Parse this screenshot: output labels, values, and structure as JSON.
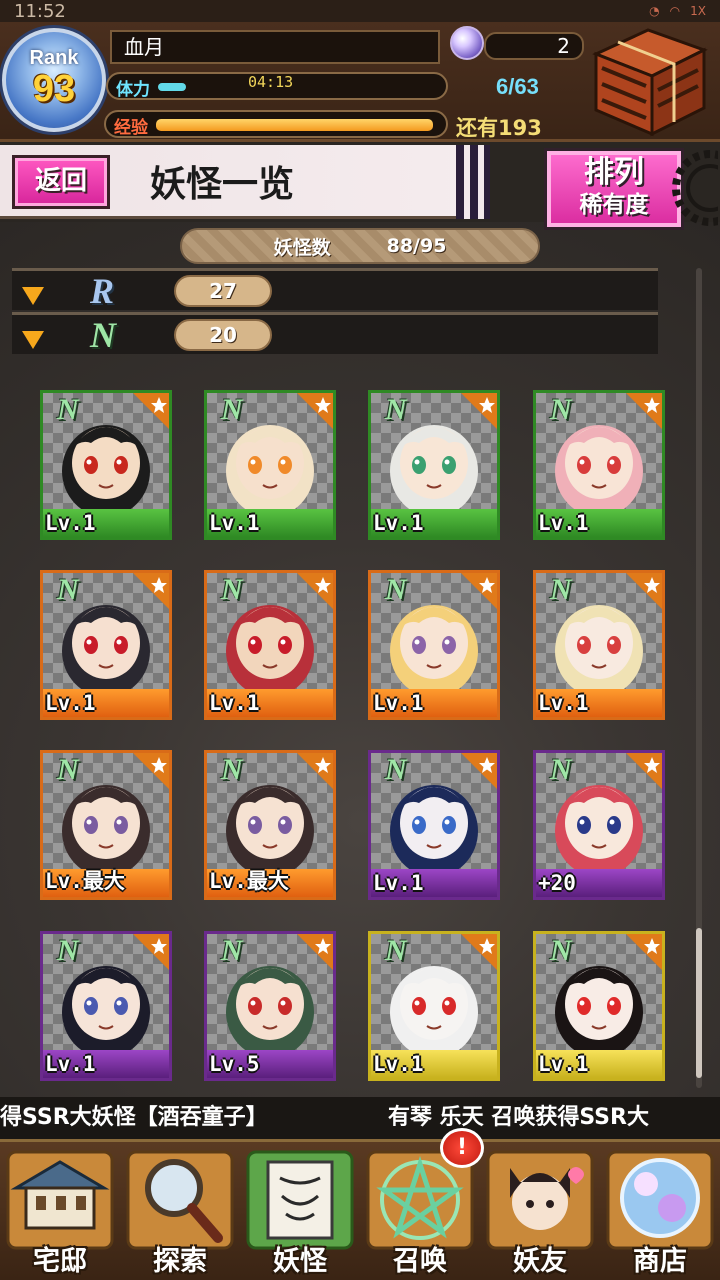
{
  "status_bar": {
    "time": "11:52",
    "right": "1X"
  },
  "player": {
    "rank_label": "Rank",
    "rank": "93",
    "name": "血月",
    "orb_count": "2",
    "stamina_label": "体力",
    "stamina_timer": "04:13",
    "stamina_count": "6/63",
    "stamina_fraction": 0.1,
    "exp_label": "经验",
    "exp_remaining": "还有193",
    "exp_fraction": 0.97
  },
  "title_bar": {
    "back_label": "返回",
    "title": "妖怪一览"
  },
  "sort_button": {
    "line1": "排列",
    "line2": "稀有度"
  },
  "yokai_count": {
    "label": "妖怪数",
    "value": "88/95"
  },
  "rarity_groups": [
    {
      "letter": "R",
      "count": "27"
    },
    {
      "letter": "N",
      "count": "20"
    }
  ],
  "cards": [
    {
      "badge": "N",
      "level": "Lv.1",
      "frame": "green",
      "hair": "#1c1c1c",
      "skin": "#f4dcc4",
      "accent": "#c8281e"
    },
    {
      "badge": "N",
      "level": "Lv.1",
      "frame": "green",
      "hair": "#f2e2c6",
      "skin": "#f6e0cc",
      "accent": "#f08a2a"
    },
    {
      "badge": "N",
      "level": "Lv.1",
      "frame": "green",
      "hair": "#e8e8e4",
      "skin": "#f8e6d6",
      "accent": "#3aa070"
    },
    {
      "badge": "N",
      "level": "Lv.1",
      "frame": "green",
      "hair": "#f0b0b8",
      "skin": "#f8e4d6",
      "accent": "#d83c3c"
    },
    {
      "badge": "N",
      "level": "Lv.1",
      "frame": "orange",
      "hair": "#2a2830",
      "skin": "#f6e0d0",
      "accent": "#c81c2a"
    },
    {
      "badge": "N",
      "level": "Lv.1",
      "frame": "orange",
      "hair": "#b8303a",
      "skin": "#f2d6bc",
      "accent": "#c81c2a"
    },
    {
      "badge": "N",
      "level": "Lv.1",
      "frame": "orange",
      "hair": "#f4d07a",
      "skin": "#f8e4d4",
      "accent": "#8c64a8"
    },
    {
      "badge": "N",
      "level": "Lv.1",
      "frame": "orange",
      "hair": "#f0e2b4",
      "skin": "#f8eae0",
      "accent": "#d84040"
    },
    {
      "badge": "N",
      "level": "Lv.最大",
      "frame": "orange",
      "hair": "#3a2c2c",
      "skin": "#f6e2d2",
      "accent": "#7a5ca0"
    },
    {
      "badge": "N",
      "level": "Lv.最大",
      "frame": "orange",
      "hair": "#3a2c2c",
      "skin": "#f6e2d2",
      "accent": "#7a5ca0"
    },
    {
      "badge": "N",
      "level": "Lv.1",
      "frame": "purple",
      "hair": "#1c2a5a",
      "skin": "#f2eef2",
      "accent": "#3a6ac8"
    },
    {
      "badge": "N",
      "level": "+20",
      "frame": "purple",
      "hair": "#d84a5a",
      "skin": "#f8e8dc",
      "accent": "#2a3a8a"
    },
    {
      "badge": "N",
      "level": "Lv.1",
      "frame": "purple",
      "hair": "#1c1c2a",
      "skin": "#f6e4d8",
      "accent": "#4a5ab0"
    },
    {
      "badge": "N",
      "level": "Lv.5",
      "frame": "purple",
      "hair": "#3a5a44",
      "skin": "#f6e0d0",
      "accent": "#c82a2a"
    },
    {
      "badge": "N",
      "level": "Lv.1",
      "frame": "yellow",
      "hair": "#f0f0f0",
      "skin": "#f6f4f2",
      "accent": "#d82a2a"
    },
    {
      "badge": "N",
      "level": "Lv.1",
      "frame": "yellow",
      "hair": "#1a1414",
      "skin": "#f8ece6",
      "accent": "#e02a2a"
    }
  ],
  "ticker": {
    "left": "得SSR大妖怪【酒吞童子】",
    "right": "有琴 乐天 召唤获得SSR大"
  },
  "nav": [
    {
      "label": "宅邸",
      "icon": "mansion-icon"
    },
    {
      "label": "探索",
      "icon": "magnifier-icon"
    },
    {
      "label": "妖怪",
      "icon": "scroll-icon"
    },
    {
      "label": "召唤",
      "icon": "pentagram-icon"
    },
    {
      "label": "妖友",
      "icon": "friend-icon"
    },
    {
      "label": "商店",
      "icon": "crystal-orb-icon"
    }
  ],
  "alert_badge": "!"
}
